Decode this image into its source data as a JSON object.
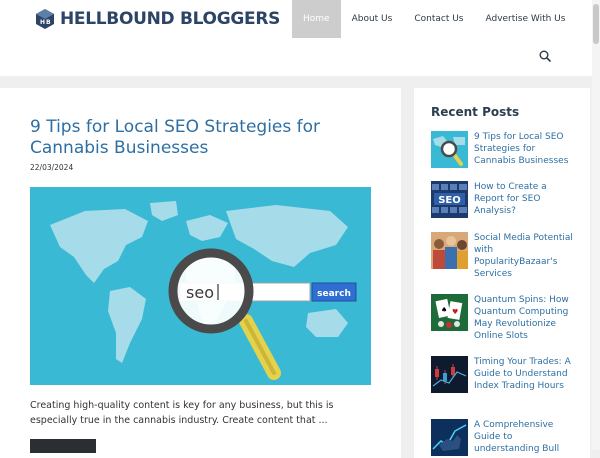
{
  "site": {
    "name": "HELLBOUND BLOGGERS",
    "logo_icon": "hb-cube-logo"
  },
  "nav": {
    "items": [
      "Home",
      "About Us",
      "Contact Us",
      "Advertise With Us"
    ],
    "active": "Home",
    "search_icon": "search-icon"
  },
  "post": {
    "title": "9 Tips for Local SEO Strategies for Cannabis Businesses",
    "date": "22/03/2024",
    "image": {
      "search_text": "seo",
      "button_label": "search"
    },
    "excerpt": "Creating high-quality content is key for any business, but this is especially true in the cannabis industry. Create content that ..."
  },
  "sidebar": {
    "title": "Recent Posts",
    "posts": [
      {
        "title": "9 Tips for Local SEO Strategies for Cannabis Businesses",
        "thumb": "map-magnifier"
      },
      {
        "title": "How to Create a Report for SEO Analysis?",
        "thumb": "seo-keyboard"
      },
      {
        "title": "Social Media Potential with PopularityBazaar's Services",
        "thumb": "people-crowd"
      },
      {
        "title": "Quantum Spins: How Quantum Computing May Revolutionize Online Slots",
        "thumb": "casino-cards"
      },
      {
        "title": "Timing Your Trades: A Guide to Understand Index Trading Hours",
        "thumb": "trading-chart"
      },
      {
        "title": "A Comprehensive Guide to understanding Bull",
        "thumb": "bull-market"
      }
    ]
  },
  "colors": {
    "link": "#2d6fa4",
    "brand": "#2c4466",
    "nav_active": "#cdcdcd"
  }
}
